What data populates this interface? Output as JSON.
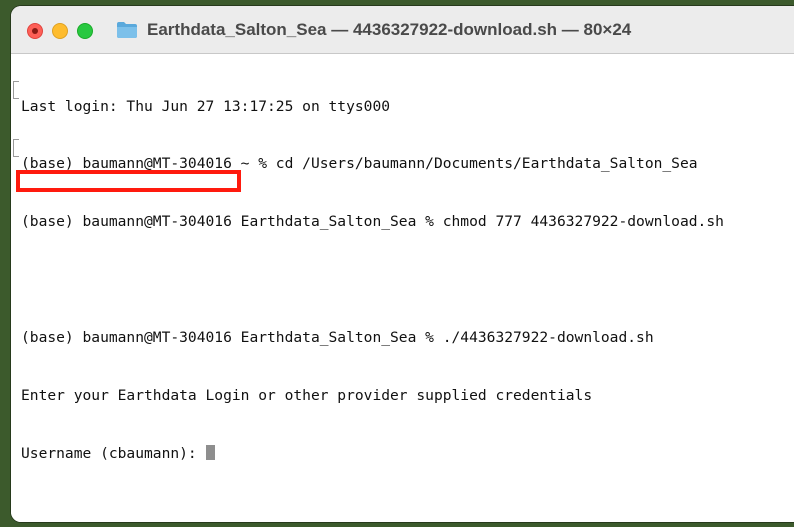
{
  "window": {
    "title": "Earthdata_Salton_Sea — 4436327922-download.sh — 80×24"
  },
  "terminal": {
    "lines": [
      "Last login: Thu Jun 27 13:17:25 on ttys000",
      "(base) baumann@MT-304016 ~ % cd /Users/baumann/Documents/Earthdata_Salton_Sea",
      "(base) baumann@MT-304016 Earthdata_Salton_Sea % chmod 777 4436327922-download.sh",
      "",
      "(base) baumann@MT-304016 Earthdata_Salton_Sea % ./4436327922-download.sh",
      "Enter your Earthdata Login or other provider supplied credentials"
    ],
    "prompt": "Username (cbaumann): "
  },
  "colors": {
    "highlight": "#ff1a0e",
    "close": "#fe5f57",
    "minimize": "#febc2e",
    "maximize": "#28c840",
    "folder": "#5aa9dc"
  }
}
